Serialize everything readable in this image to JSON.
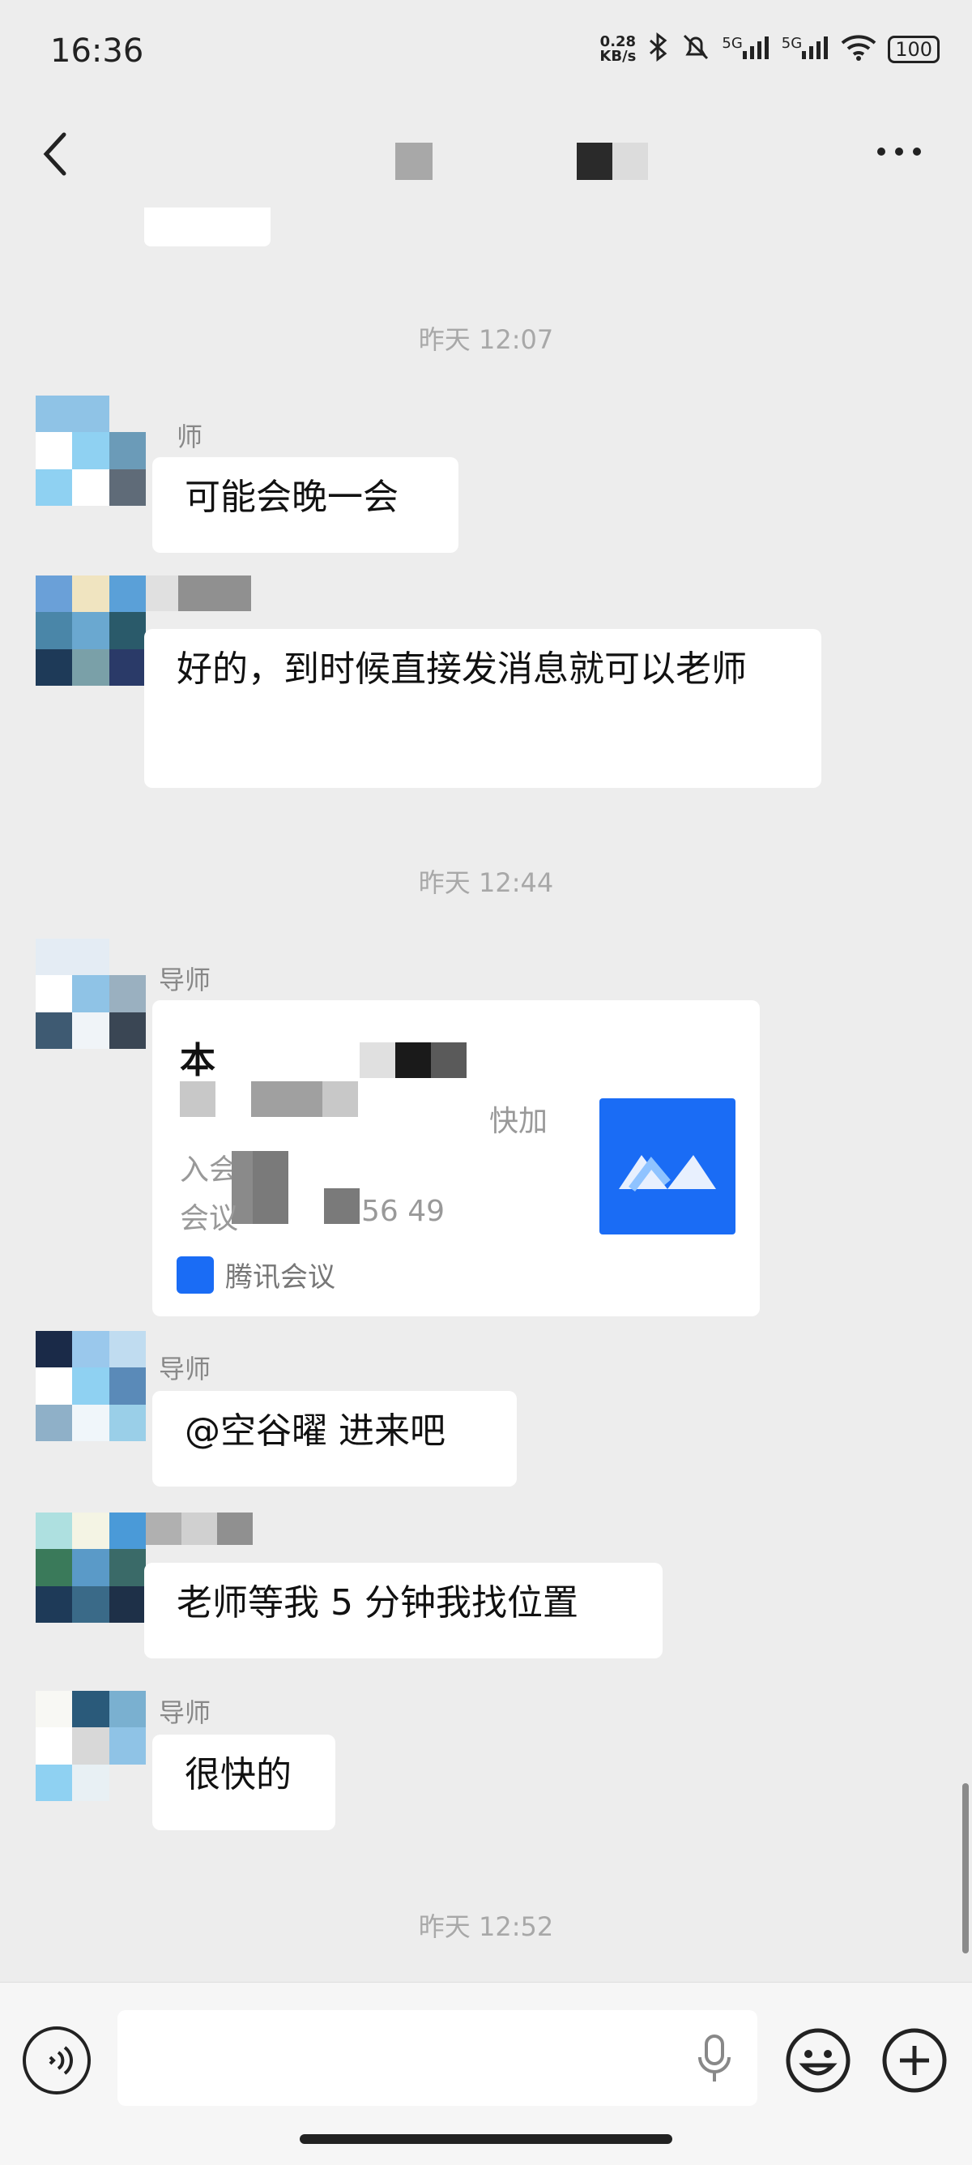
{
  "status_bar": {
    "time": "16:36",
    "netspeed_value": "0.28",
    "netspeed_unit": "KB/s",
    "signal_1": "5G",
    "signal_2": "5G",
    "battery": "100"
  },
  "header": {
    "back_icon": "chevron-left-icon",
    "more_icon": "ellipsis-icon"
  },
  "timestamps": {
    "t1": "昨天 12:07",
    "t2": "昨天 12:44",
    "t3": "昨天 12:52"
  },
  "messages": [
    {
      "sender": "导师",
      "sender_partial": "师",
      "text": "可能会晚一会"
    },
    {
      "sender": "",
      "text": "好的，到时候直接发消息就可以老师"
    },
    {
      "sender": "导师",
      "card": {
        "title_fragment": "本",
        "line1_fragment": "快加",
        "line2_fragment": "入会",
        "line3_prefix": "会议",
        "line3_fragment": "56 49",
        "source": "腾讯会议"
      }
    },
    {
      "sender": "导师",
      "text": "@空谷曜  进来吧"
    },
    {
      "sender": "",
      "text": "老师等我 5 分钟我找位置"
    },
    {
      "sender": "导师",
      "text": "很快的"
    }
  ],
  "input_bar": {
    "voice_icon": "voice-icon",
    "mic_icon": "microphone-icon",
    "emoji_icon": "emoji-icon",
    "plus_icon": "plus-icon",
    "input_value": ""
  },
  "colors": {
    "background": "#ededed",
    "bubble": "#ffffff",
    "accent": "#1a6cf5"
  }
}
